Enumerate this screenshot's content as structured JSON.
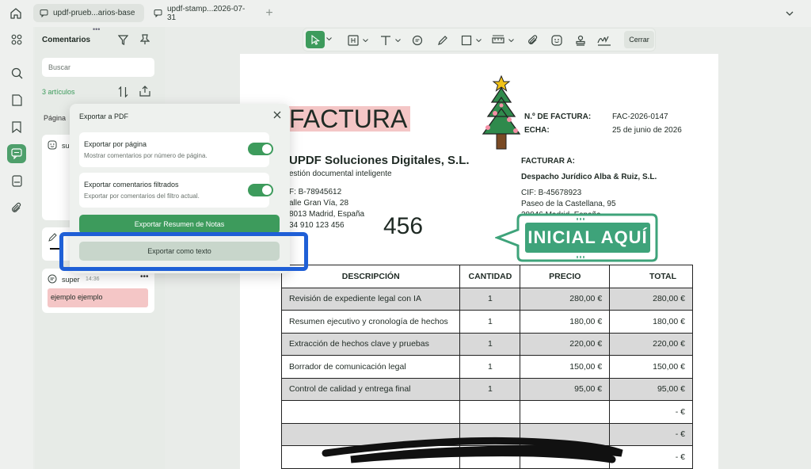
{
  "tabs": [
    {
      "label": "updf-prueb...arios-base"
    },
    {
      "label": "updf-stamp...2026-07-31"
    }
  ],
  "toolbar": {
    "close_label": "Cerrar"
  },
  "panel": {
    "title": "Comentarios",
    "search_placeholder": "Buscar",
    "count": "3 artículos",
    "sort_label": "Página",
    "card1_user": "sup",
    "card3_user": "super",
    "card3_time": "14:36",
    "card3_text": "ejemplo ejemplo"
  },
  "modal": {
    "title": "Exportar a PDF",
    "opt1_title": "Exportar por página",
    "opt1_desc": "Mostrar comentarios por número de página.",
    "opt1_on": true,
    "opt2_title": "Exportar comentarios filtrados",
    "opt2_desc": "Exportar por comentarios del filtro actual.",
    "opt2_on": true,
    "btn_summary": "Exportar Resumen de Notas",
    "btn_text": "Exportar como texto"
  },
  "invoice": {
    "title": "FACTURA",
    "company": "UPDF Soluciones Digitales, S.L.",
    "tagline": "estión documental inteligente",
    "cif": "F: B-78945612",
    "addr1": "alle Gran Vía, 28",
    "addr2": "8013 Madrid, España",
    "phone": "34 910 123 456",
    "number_label": "N.º DE FACTURA:",
    "number_value": "FAC-2026-0147",
    "date_label": "ECHA:",
    "date_value": "25 de junio de 2026",
    "bill_to_label": "FACTURAR A:",
    "client": "Despacho Jurídico Alba & Ruiz, S.L.",
    "client_cif": "CIF: B-45678923",
    "client_addr1": "Paseo de la Castellana, 95",
    "client_addr2": "28046 Madrid, España",
    "handwritten": "456",
    "stamp_text": "INICIAL AQUÍ",
    "headers": [
      "DESCRIPCIÓN",
      "CANTIDAD",
      "PRECIO",
      "TOTAL"
    ],
    "rows": [
      [
        "Revisión de expediente legal con IA",
        "1",
        "280,00 €",
        "280,00 €"
      ],
      [
        "Resumen ejecutivo y cronología de hechos",
        "1",
        "180,00 €",
        "180,00 €"
      ],
      [
        "Extracción de hechos clave y pruebas",
        "1",
        "220,00 €",
        "220,00 €"
      ],
      [
        "Borrador de comunicación legal",
        "1",
        "150,00 €",
        "150,00 €"
      ],
      [
        "Control de calidad y entrega final",
        "1",
        "95,00 €",
        "95,00 €"
      ],
      [
        "",
        "",
        "",
        "- €"
      ],
      [
        "",
        "",
        "",
        "- €"
      ],
      [
        "",
        "",
        "",
        "- €"
      ]
    ]
  },
  "colors": {
    "accent": "#3d9b5c",
    "highlight": "#f4c6c6",
    "focus_ring": "#1f5fd6",
    "stamp": "#3ea37a"
  }
}
